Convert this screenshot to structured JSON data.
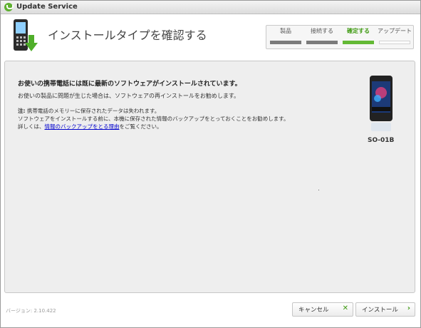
{
  "window": {
    "title": "Update Service"
  },
  "header": {
    "title": "インストールタイプを確認する",
    "steps": [
      {
        "label": "製品",
        "state": "done"
      },
      {
        "label": "接続する",
        "state": "done"
      },
      {
        "label": "確定する",
        "state": "active"
      },
      {
        "label": "アップデート",
        "state": "pending"
      }
    ]
  },
  "content": {
    "main_message": "お使いの携帯電話には既に最新のソフトウェアがインストールされています。",
    "sub_message": "お使いの製品に問題が生じた場合は、ソフトウェアの再インストールをお勧めします。",
    "note_label": "注:",
    "note_line1": "携帯電話のメモリーに保存されたデータは失われます。",
    "note_line2": "ソフトウェアをインストールする前に、本機に保存された情報のバックアップをとっておくことをお勧めします。",
    "note_line3_prefix": "詳しくは、",
    "note_link": "情報のバックアップをとる理由",
    "note_line3_suffix": "をご覧ください。",
    "device_name": "SO-01B"
  },
  "footer": {
    "version": "バージョン: 2.10.422",
    "cancel_label": "キャンセル",
    "install_label": "インストール"
  },
  "colors": {
    "accent": "#63b935",
    "link": "#0000cc"
  },
  "icons": {
    "cancel": "x-icon",
    "install": "chevron-right-icon"
  }
}
